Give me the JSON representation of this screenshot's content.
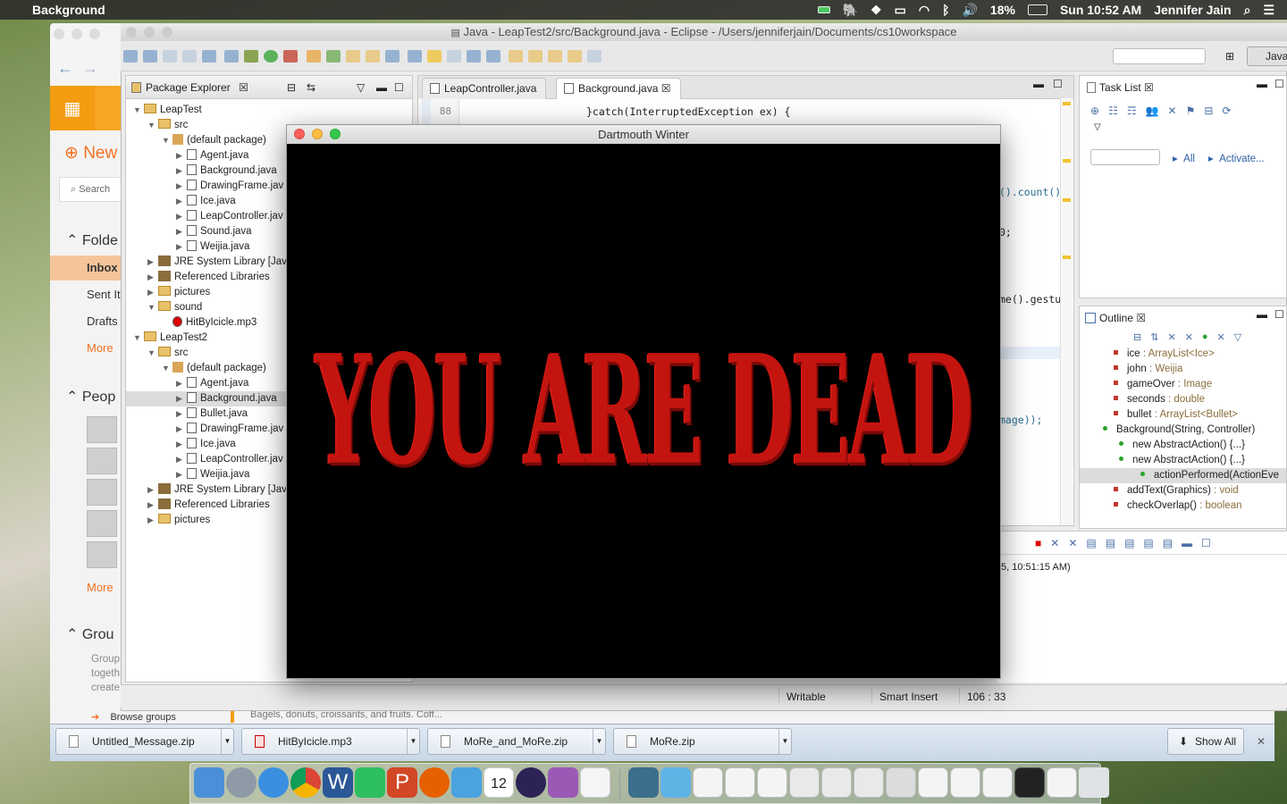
{
  "menubar": {
    "app_name": "Background",
    "battery": "18%",
    "clock": "Sun 10:52 AM",
    "user": "Jennifer Jain"
  },
  "outlook": {
    "new_label": "New",
    "search_placeholder": "Search",
    "folders_label": "Folde",
    "inbox": "Inbox",
    "sent": "Sent Ite",
    "drafts": "Drafts",
    "more1": "More",
    "people_label": "Peop",
    "more2": "More",
    "groups_label": "Grou",
    "groups_desc": [
      "Group",
      "togeth",
      "create"
    ],
    "browse_groups": "Browse groups",
    "preview_text": "Bagels, donuts, croissants, and fruits. Coff..."
  },
  "eclipse": {
    "title": "Java - LeapTest2/src/Background.java - Eclipse - /Users/jenniferjain/Documents/cs10workspace",
    "perspective": "Java",
    "package_explorer_title": "Package Explorer",
    "tree": [
      {
        "depth": 0,
        "tri": "▼",
        "icon": "project",
        "label": "LeapTest"
      },
      {
        "depth": 1,
        "tri": "▼",
        "icon": "folder",
        "label": "src"
      },
      {
        "depth": 2,
        "tri": "▼",
        "icon": "package",
        "label": "(default package)"
      },
      {
        "depth": 3,
        "tri": "▶",
        "icon": "java",
        "label": "Agent.java"
      },
      {
        "depth": 3,
        "tri": "▶",
        "icon": "java",
        "label": "Background.java"
      },
      {
        "depth": 3,
        "tri": "▶",
        "icon": "java",
        "label": "DrawingFrame.jav"
      },
      {
        "depth": 3,
        "tri": "▶",
        "icon": "java",
        "label": "Ice.java"
      },
      {
        "depth": 3,
        "tri": "▶",
        "icon": "java",
        "label": "LeapController.jav"
      },
      {
        "depth": 3,
        "tri": "▶",
        "icon": "java",
        "label": "Sound.java"
      },
      {
        "depth": 3,
        "tri": "▶",
        "icon": "java",
        "label": "Weijia.java"
      },
      {
        "depth": 1,
        "tri": "▶",
        "icon": "lib",
        "label": "JRE System Library [Jav"
      },
      {
        "depth": 1,
        "tri": "▶",
        "icon": "lib",
        "label": "Referenced Libraries"
      },
      {
        "depth": 1,
        "tri": "▶",
        "icon": "folder",
        "label": "pictures"
      },
      {
        "depth": 1,
        "tri": "▼",
        "icon": "folder",
        "label": "sound"
      },
      {
        "depth": 2,
        "tri": "",
        "icon": "mp3",
        "label": "HitByIcicle.mp3"
      },
      {
        "depth": 0,
        "tri": "▼",
        "icon": "project",
        "label": "LeapTest2"
      },
      {
        "depth": 1,
        "tri": "▼",
        "icon": "folder",
        "label": "src"
      },
      {
        "depth": 2,
        "tri": "▼",
        "icon": "package",
        "label": "(default package)"
      },
      {
        "depth": 3,
        "tri": "▶",
        "icon": "java",
        "label": "Agent.java"
      },
      {
        "depth": 3,
        "tri": "▶",
        "icon": "java",
        "label": "Background.java",
        "selected": true
      },
      {
        "depth": 3,
        "tri": "▶",
        "icon": "java",
        "label": "Bullet.java"
      },
      {
        "depth": 3,
        "tri": "▶",
        "icon": "java",
        "label": "DrawingFrame.jav"
      },
      {
        "depth": 3,
        "tri": "▶",
        "icon": "java",
        "label": "Ice.java"
      },
      {
        "depth": 3,
        "tri": "▶",
        "icon": "java",
        "label": "LeapController.jav"
      },
      {
        "depth": 3,
        "tri": "▶",
        "icon": "java",
        "label": "Weijia.java"
      },
      {
        "depth": 1,
        "tri": "▶",
        "icon": "lib",
        "label": "JRE System Library [Jav"
      },
      {
        "depth": 1,
        "tri": "▶",
        "icon": "lib",
        "label": "Referenced Libraries"
      },
      {
        "depth": 1,
        "tri": "▶",
        "icon": "folder",
        "label": "pictures"
      }
    ],
    "editor_tabs": [
      "LeapController.java",
      "Background.java"
    ],
    "line_88": "88",
    "code_88": "}catch(InterruptedException ex) {",
    "code_frag1": "().count()",
    "code_frag2": "0;",
    "code_frag3": "me().gestu",
    "code_frag4": "mage));",
    "task_list_title": "Task List",
    "task_filter_all": "All",
    "task_activate": "Activate...",
    "outline_title": "Outline",
    "outline": [
      {
        "label": "ice",
        "type": " : ArrayList<Ice>"
      },
      {
        "label": "john",
        "type": " : Weijia"
      },
      {
        "label": "gameOver",
        "type": " : Image"
      },
      {
        "label": "seconds",
        "type": " : double"
      },
      {
        "label": "bullet",
        "type": " : ArrayList<Bullet>"
      },
      {
        "label": "Background(String, Controller)",
        "type": ""
      },
      {
        "label": "new AbstractAction() {...}",
        "type": ""
      },
      {
        "label": "new AbstractAction() {...}",
        "type": ""
      },
      {
        "label": "actionPerformed(ActionEve",
        "type": ""
      },
      {
        "label": "addText(Graphics)",
        "type": " : void"
      },
      {
        "label": "checkOverlap()",
        "type": " : boolean"
      }
    ],
    "console_text": "5, 10:51:15 AM)",
    "status_writable": "Writable",
    "status_insert": "Smart Insert",
    "status_pos": "106 : 33"
  },
  "game": {
    "title": "Dartmouth Winter",
    "message": "YOU ARE DEAD",
    "message_color": "#c4140f"
  },
  "downloads": {
    "items": [
      "Untitled_Message.zip",
      "HitByIcicle.mp3",
      "MoRe_and_MoRe.zip",
      "MoRe.zip"
    ],
    "show_all": "Show All"
  },
  "dock": {
    "calendar_day": "12"
  }
}
